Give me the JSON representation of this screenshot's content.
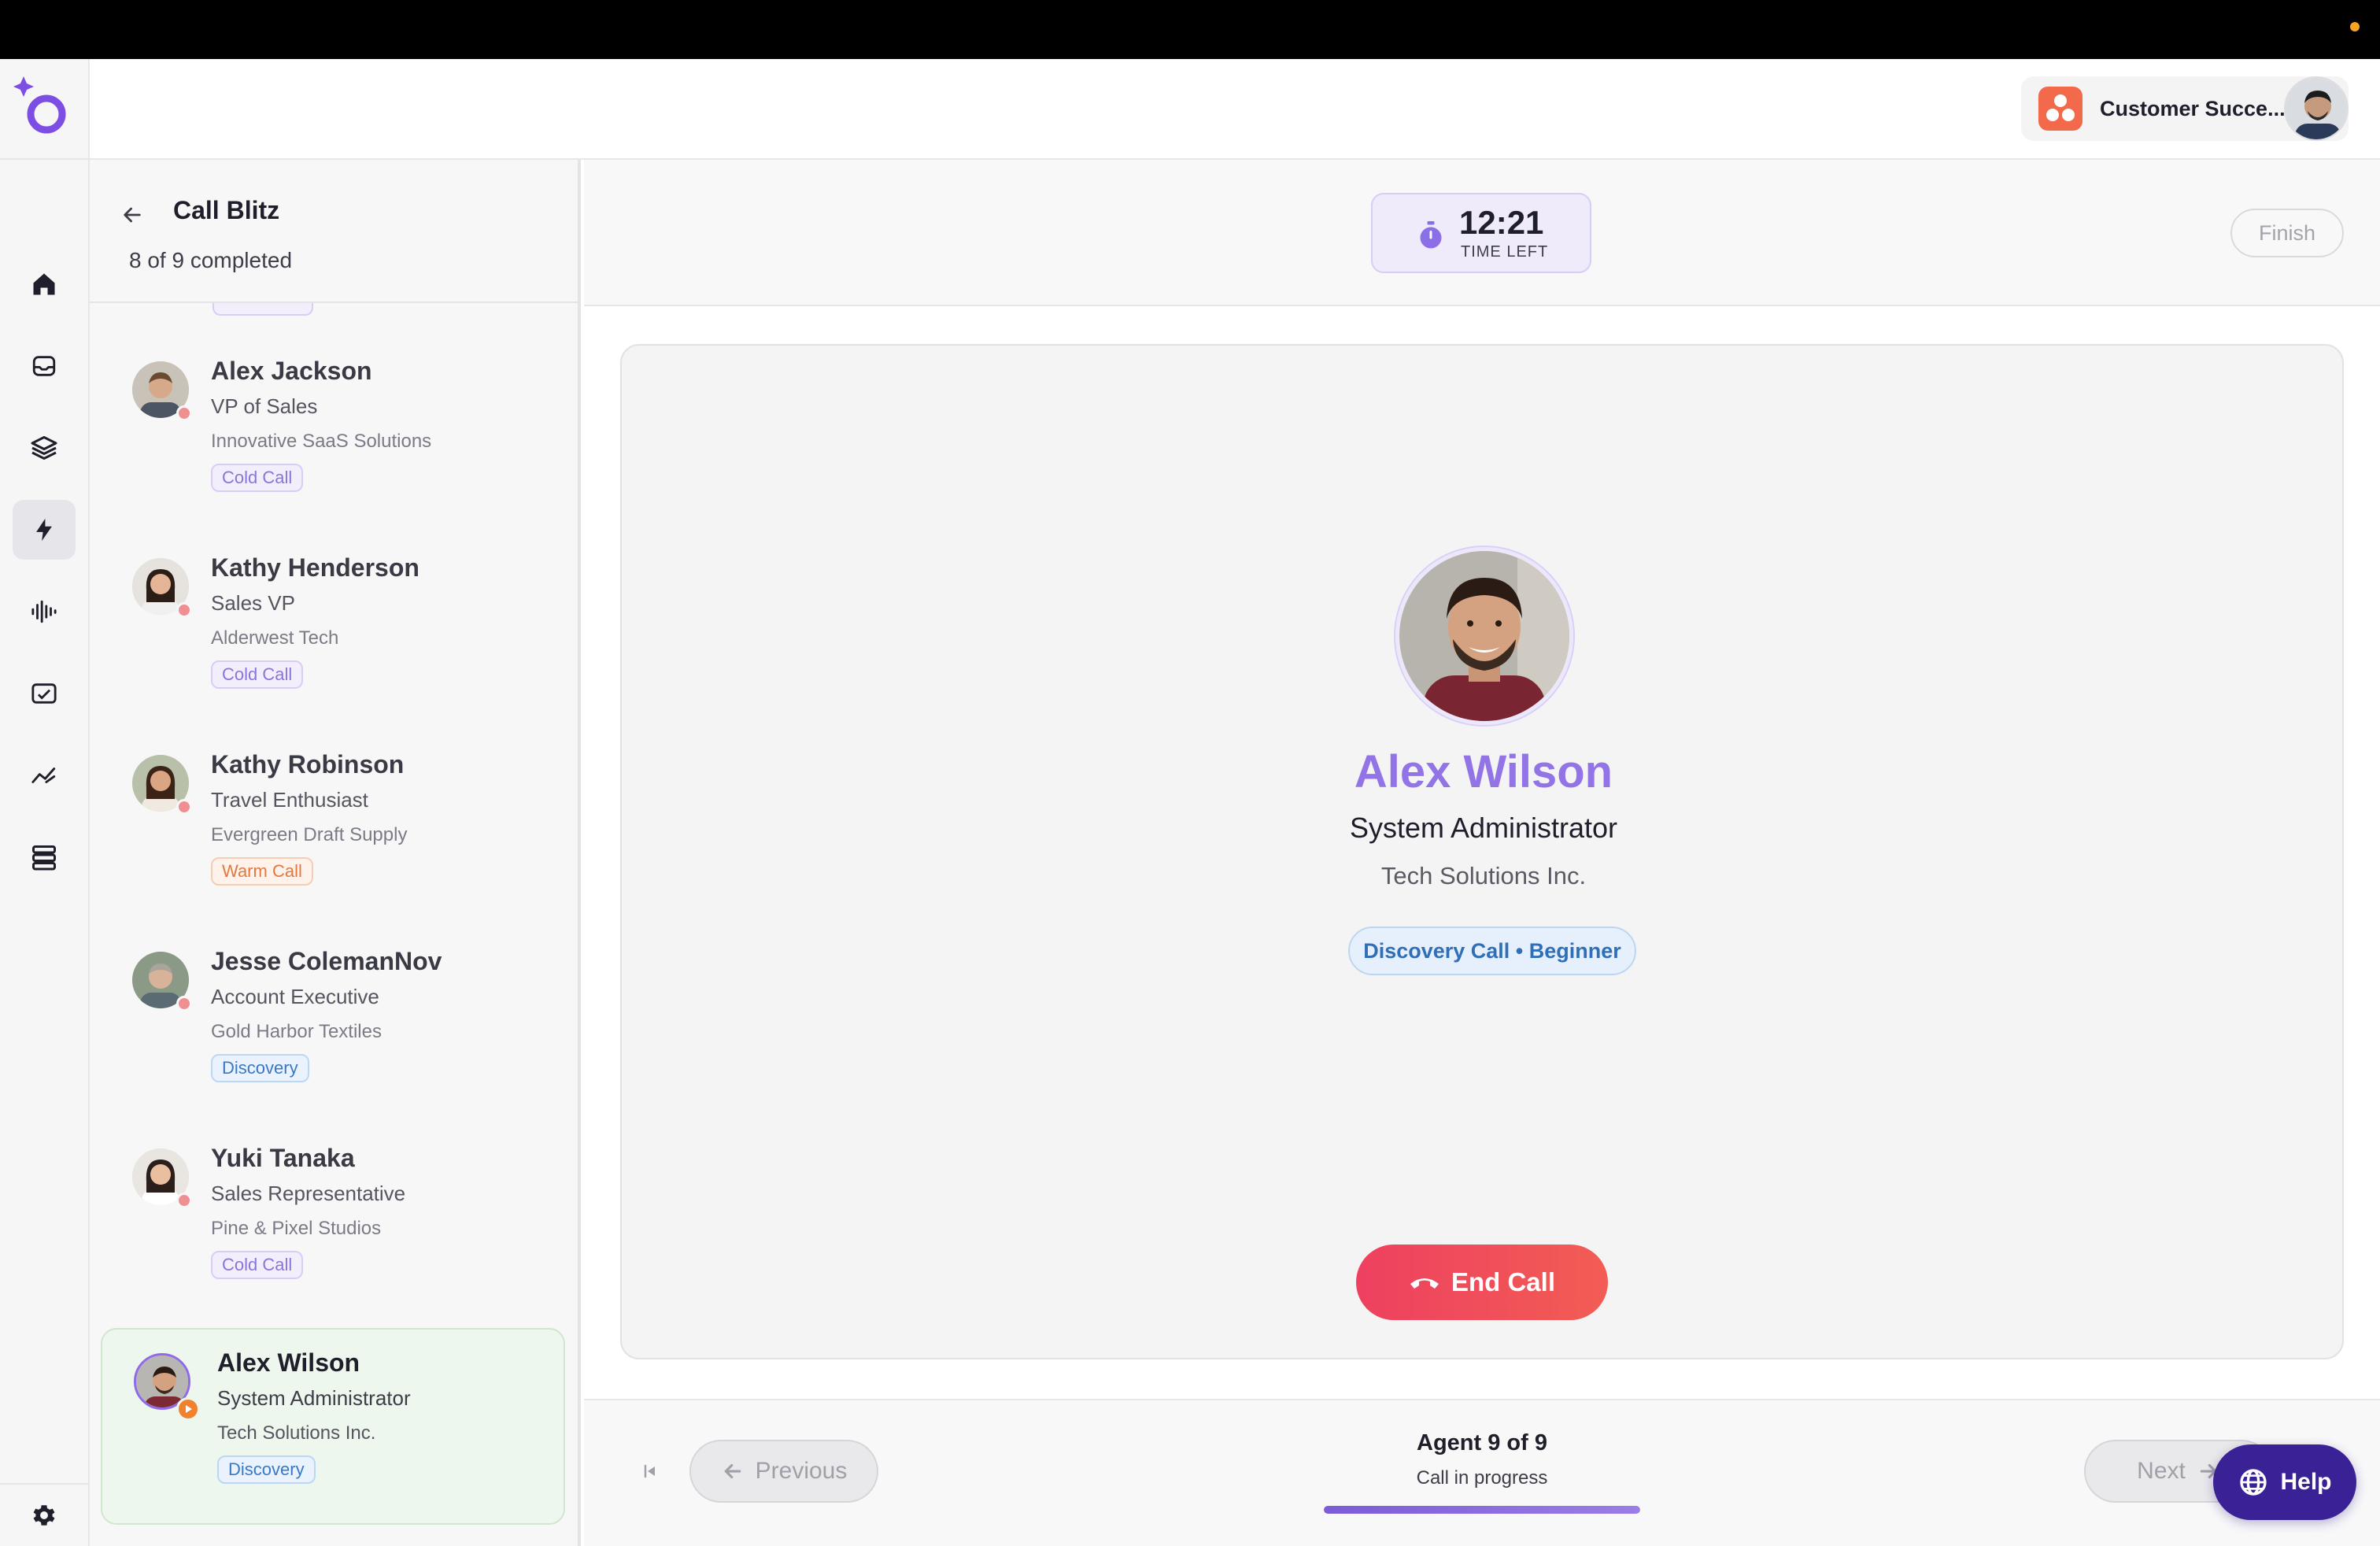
{
  "workspace": {
    "name": "Customer Succe...",
    "logo_color": "#f26a4b"
  },
  "call_blitz": {
    "title": "Call Blitz",
    "progress_text": "8 of 9 completed"
  },
  "contacts": [
    {
      "name": "Alex Jackson",
      "role": "VP of Sales",
      "company": "Innovative SaaS Solutions",
      "tag": "Cold Call",
      "tag_color": "purple"
    },
    {
      "name": "Kathy Henderson",
      "role": "Sales VP",
      "company": "Alderwest Tech",
      "tag": "Cold Call",
      "tag_color": "purple"
    },
    {
      "name": "Kathy Robinson",
      "role": "Travel Enthusiast",
      "company": "Evergreen Draft Supply",
      "tag": "Warm Call",
      "tag_color": "orange"
    },
    {
      "name": "Jesse ColemanNov",
      "role": "Account Executive",
      "company": "Gold Harbor Textiles",
      "tag": "Discovery",
      "tag_color": "blue"
    },
    {
      "name": "Yuki Tanaka",
      "role": "Sales Representative",
      "company": "Pine & Pixel Studios",
      "tag": "Cold Call",
      "tag_color": "purple"
    },
    {
      "name": "Alex Wilson",
      "role": "System Administrator",
      "company": "Tech Solutions Inc.",
      "tag": "Discovery",
      "tag_color": "blue"
    }
  ],
  "timer": {
    "value": "12:21",
    "label": "TIME LEFT"
  },
  "finish_label": "Finish",
  "agent": {
    "name": "Alex Wilson",
    "role": "System Administrator",
    "company": "Tech Solutions Inc.",
    "chip": "Discovery Call • Beginner"
  },
  "end_call_label": "End Call",
  "footer": {
    "previous_label": "Previous",
    "next_label": "Next",
    "title": "Agent 9 of 9",
    "status": "Call in progress",
    "progress_fraction": 1.0
  },
  "help_label": "Help",
  "colors": {
    "accent": "#9274e6",
    "danger": "#ee4060",
    "help": "#3a2196"
  }
}
